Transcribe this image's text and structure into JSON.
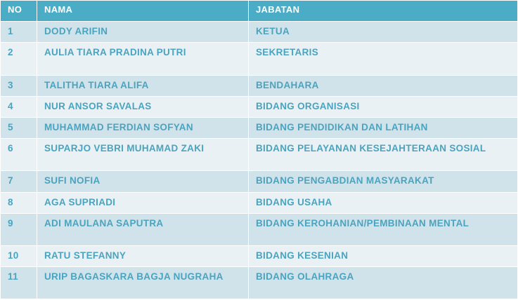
{
  "table": {
    "headers": [
      "NO",
      "NAMA",
      "JABATAN"
    ],
    "rows": [
      {
        "no": "1",
        "nama": "DODY ARIFIN",
        "jabatan": "KETUA"
      },
      {
        "no": "2",
        "nama": "AULIA  TIARA PRADINA PUTRI",
        "jabatan": "SEKRETARIS"
      },
      {
        "no": "3",
        "nama": "TALITHA TIARA ALIFA",
        "jabatan": "BENDAHARA"
      },
      {
        "no": "4",
        "nama": "NUR ANSOR SAVALAS",
        "jabatan": "BIDANG ORGANISASI"
      },
      {
        "no": "5",
        "nama": "MUHAMMAD FERDIAN SOFYAN",
        "jabatan": "BIDANG PENDIDIKAN DAN LATIHAN"
      },
      {
        "no": "6",
        "nama": "SUPARJO VEBRI MUHAMAD ZAKI",
        "jabatan": "BIDANG PELAYANAN  KESEJAHTERAAN  SOSIAL"
      },
      {
        "no": "7",
        "nama": "SUFI NOFIA",
        "jabatan": "BIDANG PENGABDIAN MASYARAKAT"
      },
      {
        "no": "8",
        "nama": "AGA  SUPRIADI",
        "jabatan": "BIDANG USAHA"
      },
      {
        "no": "9",
        "nama": "ADI MAULANA  SAPUTRA",
        "jabatan": "BIDANG KEROHANIAN/PEMBINAAN  MENTAL"
      },
      {
        "no": "10",
        "nama": "RATU STEFANNY",
        "jabatan": "BIDANG KESENIAN"
      },
      {
        "no": "11",
        "nama": "URIP BAGASKARA  BAGJA NUGRAHA",
        "jabatan": "BIDANG OLAHRAGA"
      }
    ]
  }
}
